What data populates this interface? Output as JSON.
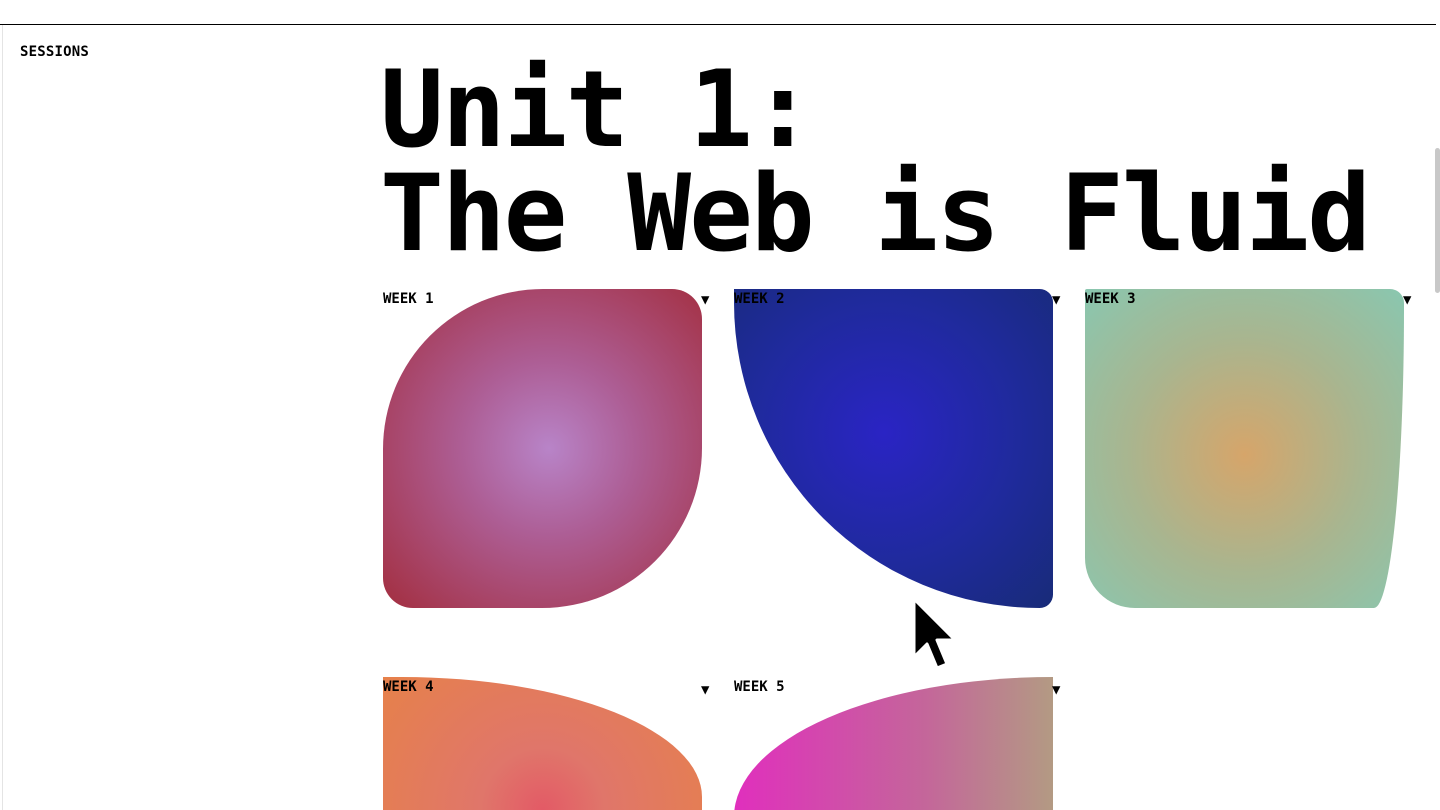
{
  "sidebar": {
    "label": "SESSIONS"
  },
  "unit": {
    "title_line1": "Unit 1:",
    "title_line2": "The Web is Fluid"
  },
  "weeks": [
    {
      "label": "WEEK 1",
      "toggle": "▼"
    },
    {
      "label": "WEEK 2",
      "toggle": "▼"
    },
    {
      "label": "WEEK 3",
      "toggle": "▼"
    },
    {
      "label": "WEEK 4",
      "toggle": "▼"
    },
    {
      "label": "WEEK 5",
      "toggle": "▼"
    }
  ],
  "colors": {
    "week1": "#ad5e95",
    "week2": "#1f2a9c",
    "week3": "#a9b58f",
    "week4": "#e0766a",
    "week5": "#c4669a"
  }
}
